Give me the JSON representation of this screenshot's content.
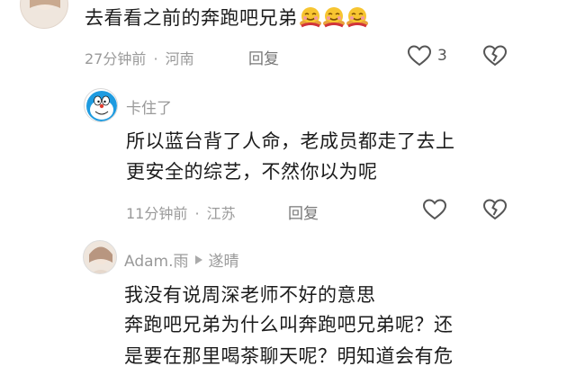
{
  "comment1": {
    "text": "去看看之前的奔跑吧兄弟",
    "emojis": [
      "hugging-face-icon",
      "hugging-face-icon",
      "hugging-face-icon"
    ],
    "time": "27分钟前",
    "sep": "·",
    "location": "河南",
    "reply_label": "回复",
    "like_count": "3"
  },
  "reply1": {
    "user": "卡住了",
    "line1": "所以蓝台背了人命，老成员都走了去上",
    "line2": "更安全的综艺，不然你以为呢",
    "time": "11分钟前",
    "sep": "·",
    "location": "江苏",
    "reply_label": "回复"
  },
  "reply2": {
    "user": "Adam.雨",
    "reply_to": "遂晴",
    "line1": "我没有说周深老师不好的意思",
    "line2": "奔跑吧兄弟为什么叫奔跑吧兄弟呢？还",
    "line3": "是要在那里喝茶聊天呢？明知道会有危"
  },
  "colors": {
    "text": "#1c1c1c",
    "meta": "#9a9a9a",
    "icon": "#555555"
  }
}
